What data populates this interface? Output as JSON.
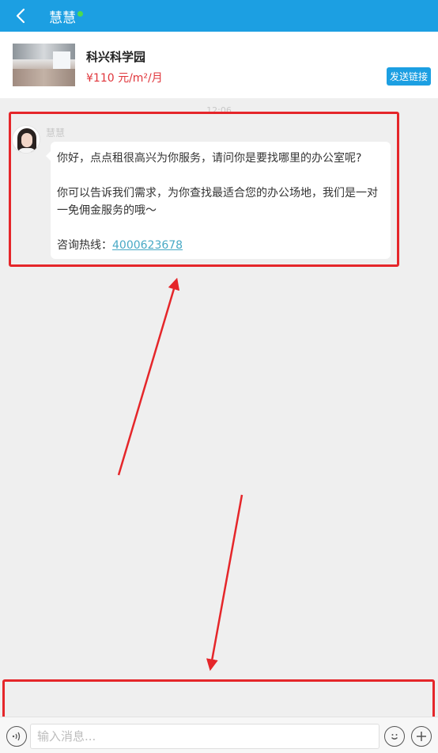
{
  "header": {
    "title": "慧慧",
    "back_icon": "chevron-left-icon",
    "online_color": "#4ddb4d",
    "bar_color": "#1c9fe2"
  },
  "property_card": {
    "name": "科兴科学园",
    "price": "¥110 元/m²/月",
    "send_link_label": "发送链接",
    "price_color": "#e0353b"
  },
  "chat": {
    "timestamp": "12:06",
    "sender": "慧慧",
    "message": {
      "paragraph_1": "你好，点点租很高兴为你服务，请问你是要找哪里的办公室呢?",
      "paragraph_2": "你可以告诉我们需求，为你查找最适合您的办公场地，我们是一对一免佣金服务的哦～",
      "hotline_label": "咨询热线：",
      "hotline_number": "4000623678"
    }
  },
  "input_bar": {
    "placeholder": "输入消息...",
    "value": "",
    "voice_icon": "voice-icon",
    "emoji_icon": "emoji-icon",
    "plus_icon": "plus-icon"
  },
  "annotations": {
    "color": "#e5262a"
  }
}
